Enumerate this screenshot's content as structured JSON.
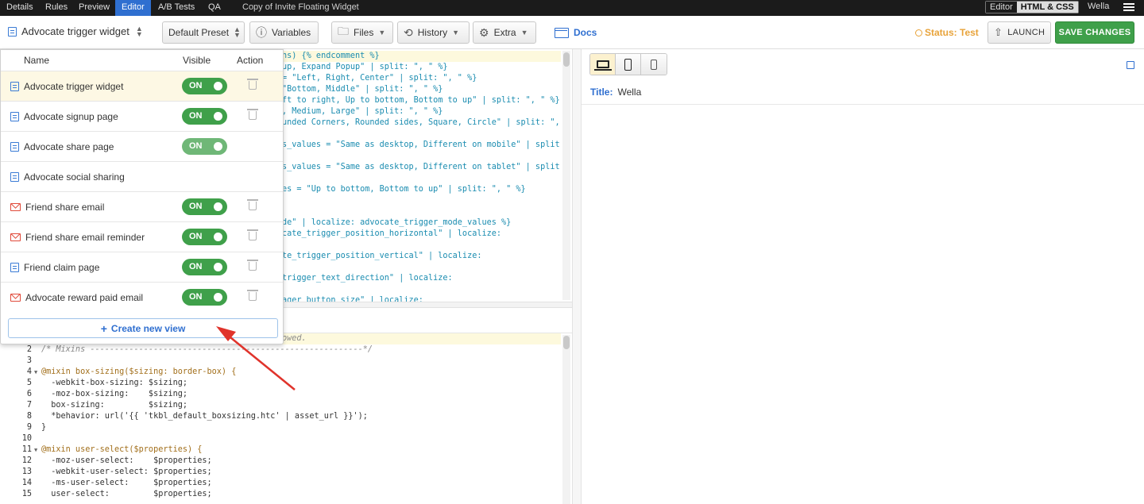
{
  "topnav": {
    "tabs": [
      "Details",
      "Rules",
      "Preview",
      "Editor",
      "A/B Tests",
      "QA"
    ],
    "active_tab": "Editor",
    "page_title": "Copy of Invite Floating Widget",
    "mode_toggle": [
      "Editor",
      "HTML & CSS"
    ],
    "user": "Wella"
  },
  "toolbar": {
    "widget_selector": "Advocate trigger widget",
    "preset": "Default Preset",
    "variables": "Variables",
    "files": "Files",
    "history": "History",
    "extra": "Extra",
    "docs": "Docs",
    "status": "Status: Test",
    "launch": "LAUNCH",
    "save": "SAVE CHANGES"
  },
  "views_dropdown": {
    "headers": {
      "name": "Name",
      "visible": "Visible",
      "action": "Action"
    },
    "rows": [
      {
        "name": "Advocate trigger widget",
        "icon": "page-icon",
        "toggle": "ON",
        "trash": true,
        "selected": true
      },
      {
        "name": "Advocate signup page",
        "icon": "page-icon",
        "toggle": "ON",
        "trash": true
      },
      {
        "name": "Advocate share page",
        "icon": "page-icon",
        "toggle": "ON",
        "trash": false
      },
      {
        "name": "Advocate social sharing",
        "icon": "page-icon",
        "toggle": "",
        "trash": false
      },
      {
        "name": "Friend share email",
        "icon": "mail-icon",
        "toggle": "ON",
        "trash": true
      },
      {
        "name": "Friend share email reminder",
        "icon": "mail-icon",
        "toggle": "ON",
        "trash": true
      },
      {
        "name": "Friend claim page",
        "icon": "page-icon",
        "toggle": "ON",
        "trash": true
      },
      {
        "name": "Advocate reward paid email",
        "icon": "mail-icon",
        "toggle": "ON",
        "trash": true
      }
    ],
    "create_button": "Create new view"
  },
  "code_top_lines": [
    "ns) {% endcomment %}",
    "up, Expand Popup\" | split: \", \" %}",
    "= \"Left, Right, Center\" | split: \", \" %}",
    "\"Bottom, Middle\" | split: \", \" %}",
    "ft to right, Up to bottom, Bottom to up\" | split: \", \" %}",
    ", Medium, Large\" | split: \", \" %}",
    "unded Corners, Rounded sides, Square, Circle\" | split: \", \"",
    "",
    "s_values = \"Same as desktop, Different on mobile\" | split:",
    "",
    "s_values = \"Same as desktop, Different on tablet\" | split:",
    "",
    "es = \"Up to bottom, Bottom to up\" | split: \", \" %}",
    "",
    "",
    "de\" | localize: advocate_trigger_mode_values %}",
    "cate_trigger_position_horizontal\" | localize:",
    "",
    "te_trigger_position_vertical\" | localize:",
    "",
    "trigger_text_direction\" | localize:",
    "",
    "ager_button_size\" | localize:"
  ],
  "code_bottom_partial": "owed.",
  "code_bottom_lines": [
    {
      "n": "2",
      "text": "/* Mixins --------------------------------------------------------*/"
    },
    {
      "n": "3",
      "text": ""
    },
    {
      "n": "4",
      "text": "@mixin box-sizing($sizing: border-box) {"
    },
    {
      "n": "5",
      "text": "  -webkit-box-sizing: $sizing;"
    },
    {
      "n": "6",
      "text": "  -moz-box-sizing:    $sizing;"
    },
    {
      "n": "7",
      "text": "  box-sizing:         $sizing;"
    },
    {
      "n": "8",
      "text": "  *behavior: url('{{ 'tkbl_default_boxsizing.htc' | asset_url }}');"
    },
    {
      "n": "9",
      "text": "}"
    },
    {
      "n": "10",
      "text": ""
    },
    {
      "n": "11",
      "text": "@mixin user-select($properties) {"
    },
    {
      "n": "12",
      "text": "  -moz-user-select:    $properties;"
    },
    {
      "n": "13",
      "text": "  -webkit-user-select: $properties;"
    },
    {
      "n": "14",
      "text": "  -ms-user-select:     $properties;"
    },
    {
      "n": "15",
      "text": "  user-select:         $properties;"
    }
  ],
  "preview": {
    "title_label": "Title:",
    "title_value": "Wella"
  },
  "colors": {
    "accent": "#2f6fd0",
    "save_green": "#3fa04a",
    "status_orange": "#e8a33a",
    "annotation_arrow": "#e0332b"
  }
}
